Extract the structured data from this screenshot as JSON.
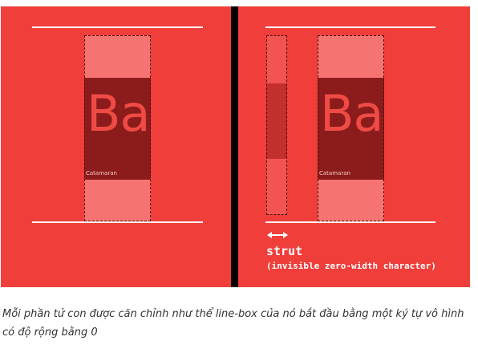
{
  "left_panel": {
    "glyph": "Ba",
    "font_label": "Catamaran"
  },
  "right_panel": {
    "glyph": "Ba",
    "font_label": "Catamaran",
    "strut_label": "strut",
    "strut_description": "(invisible zero-width character)",
    "arrow_icon": "double-headed-arrow"
  },
  "colors": {
    "background": "#f03e3b",
    "box_padding": "#f57371",
    "box_core": "#8c1c1c",
    "divider": "#000000"
  },
  "caption": "Mỗi phần tử con được căn chỉnh như thể line-box của nó bắt đầu bằng một ký tự vô hình có độ rộng bằng 0"
}
